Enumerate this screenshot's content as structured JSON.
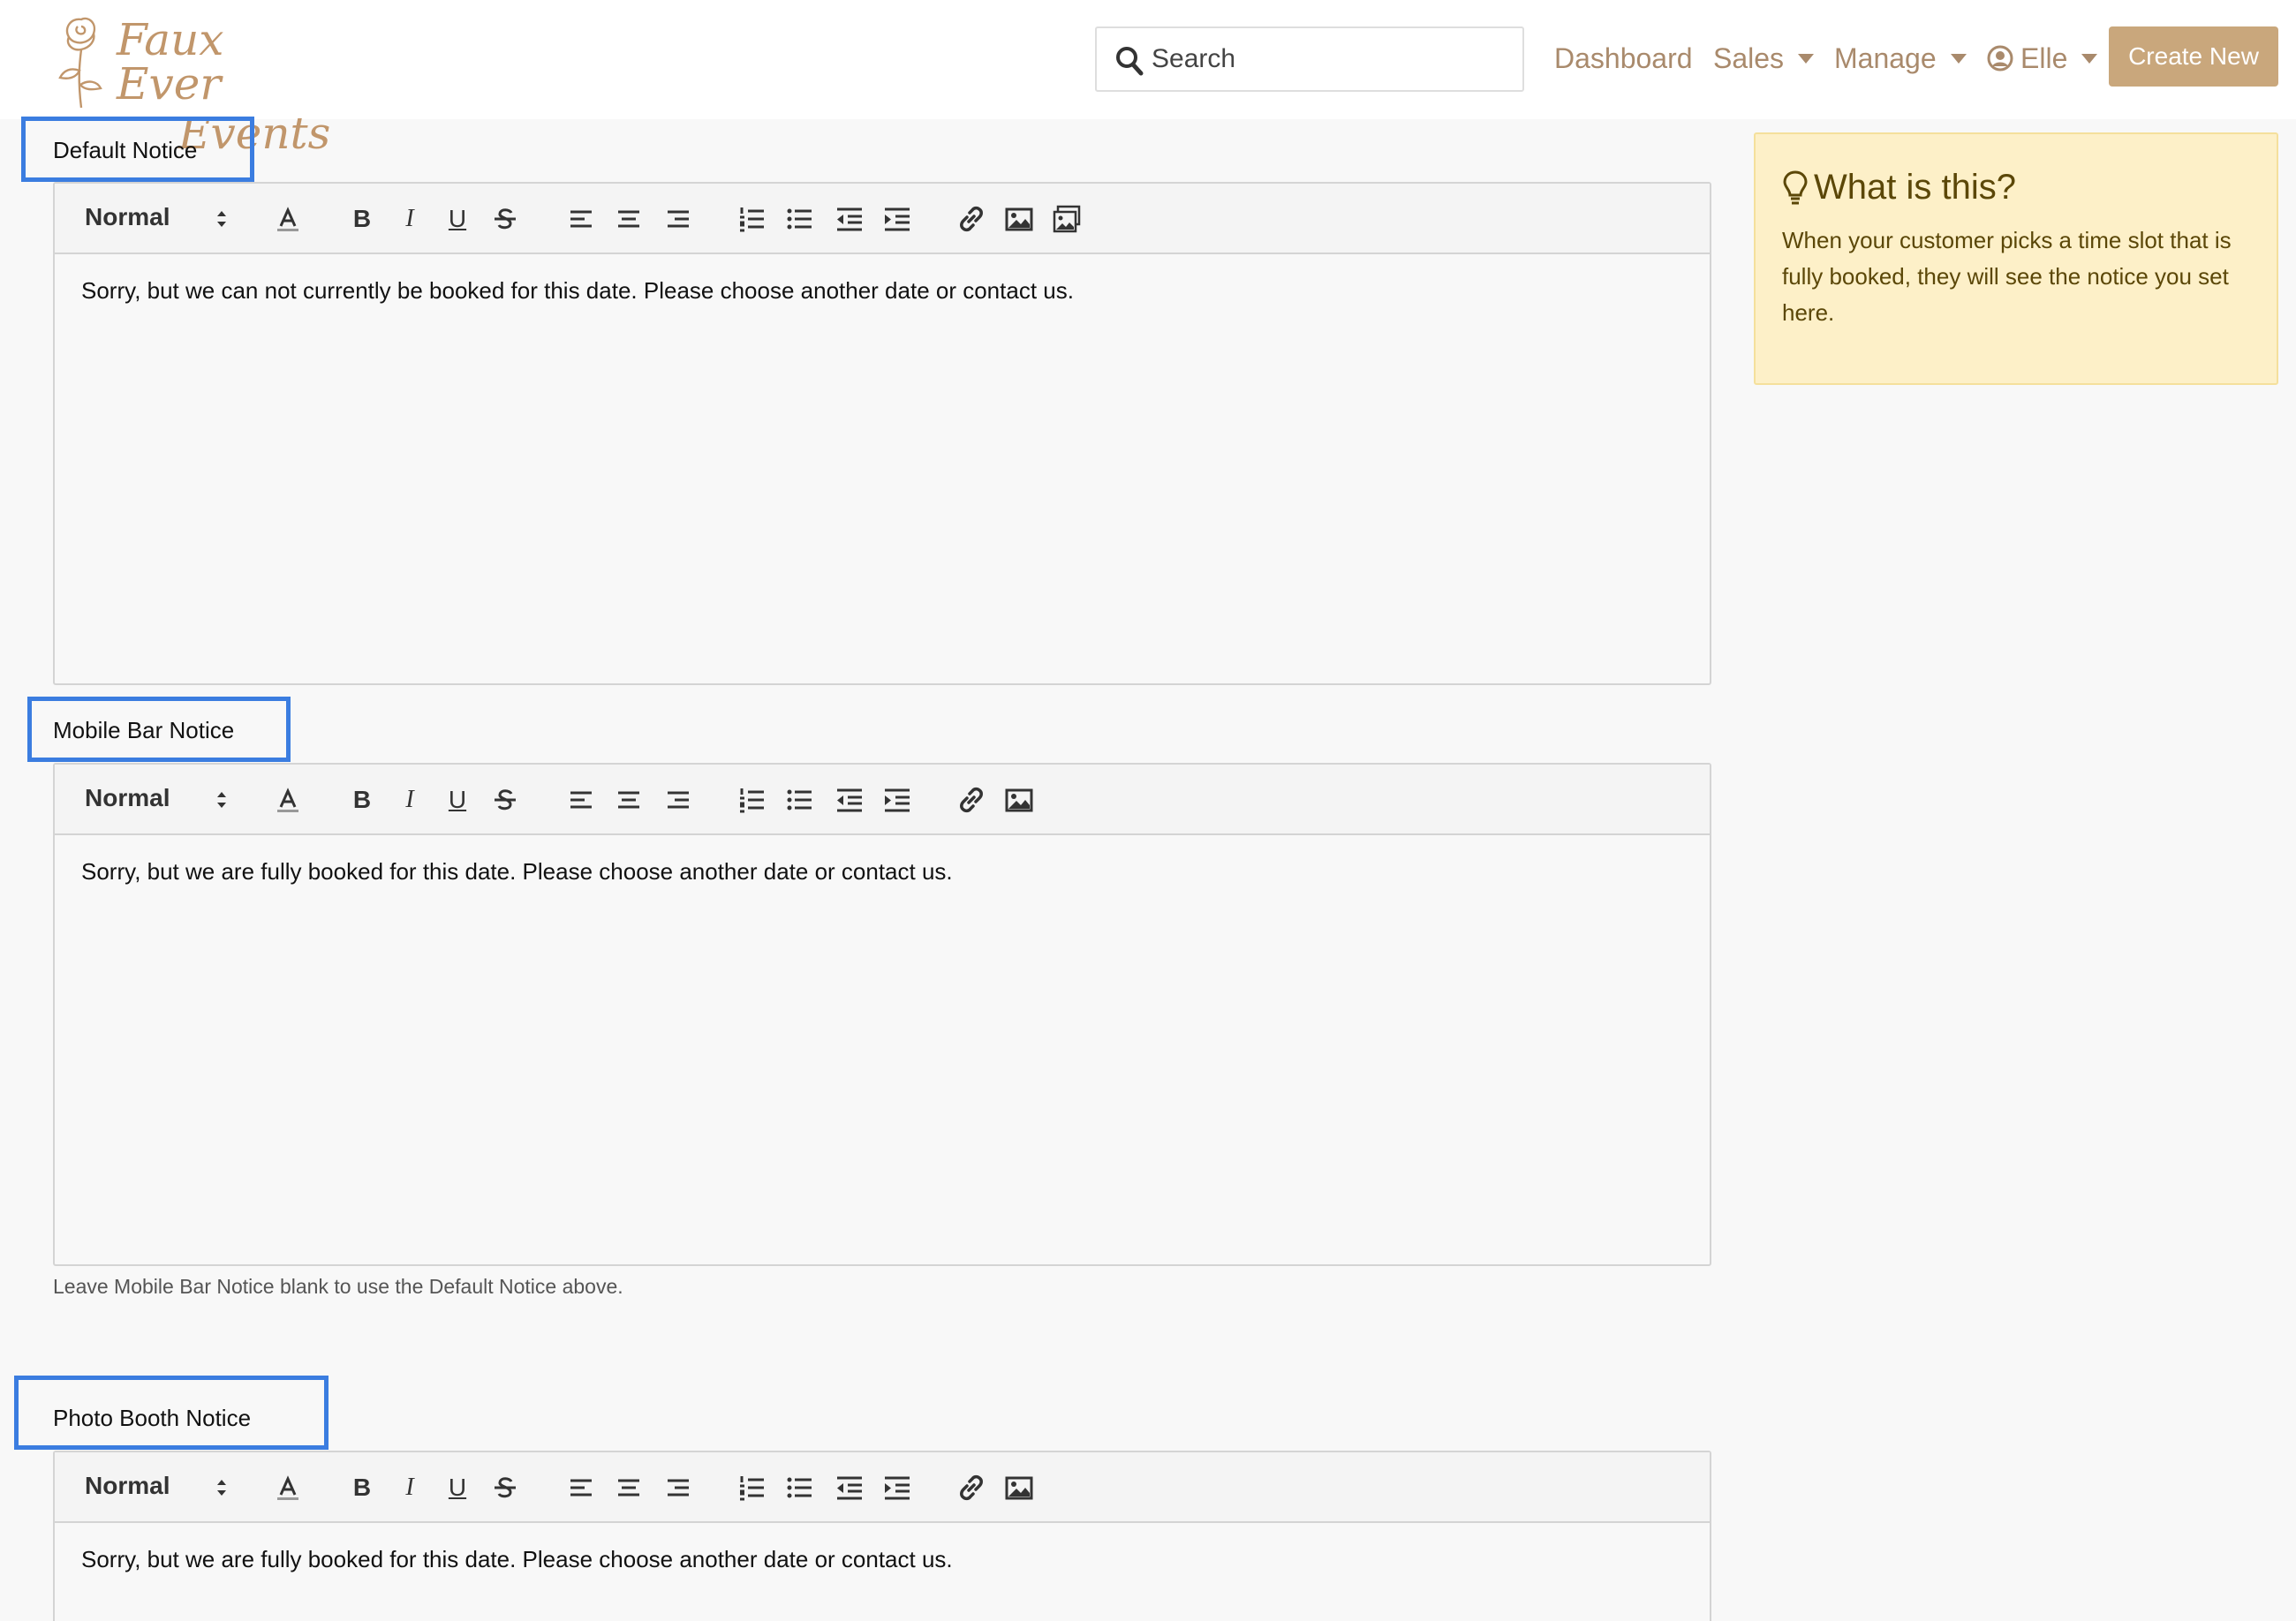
{
  "brand": {
    "line1": "Faux Ever",
    "line2": "Events"
  },
  "search": {
    "placeholder": "Search"
  },
  "nav": {
    "dashboard": "Dashboard",
    "sales": "Sales",
    "manage": "Manage",
    "user": "Elle",
    "create": "Create New"
  },
  "colors": {
    "accent": "#c9a77c",
    "nav_text": "#a98a6c",
    "label_border": "#3b7de0",
    "info_bg": "#fdf0c8",
    "info_text": "#5b4708"
  },
  "editor": {
    "format_value": "Normal",
    "bold": "B",
    "italic": "I",
    "underline": "U",
    "icons": [
      "text-color-icon",
      "bold-icon",
      "italic-icon",
      "underline-icon",
      "strikethrough-icon",
      "align-left-icon",
      "align-center-icon",
      "align-right-icon",
      "ordered-list-icon",
      "bullet-list-icon",
      "outdent-icon",
      "indent-icon",
      "link-icon",
      "image-icon",
      "gallery-icon"
    ]
  },
  "notices": [
    {
      "label": "Default Notice",
      "content": "Sorry, but we can not currently be booked for this date. Please choose another date or contact us."
    },
    {
      "label": "Mobile Bar Notice",
      "content": "Sorry, but we are fully booked for this date. Please choose another date or contact us.",
      "help": "Leave Mobile Bar Notice blank to use the Default Notice above."
    },
    {
      "label": "Photo Booth Notice",
      "content": "Sorry, but we are fully booked for this date. Please choose another date or contact us."
    }
  ],
  "info": {
    "title": "What is this?",
    "body": "When your customer picks a time slot that is fully booked, they will see the notice you set here."
  }
}
